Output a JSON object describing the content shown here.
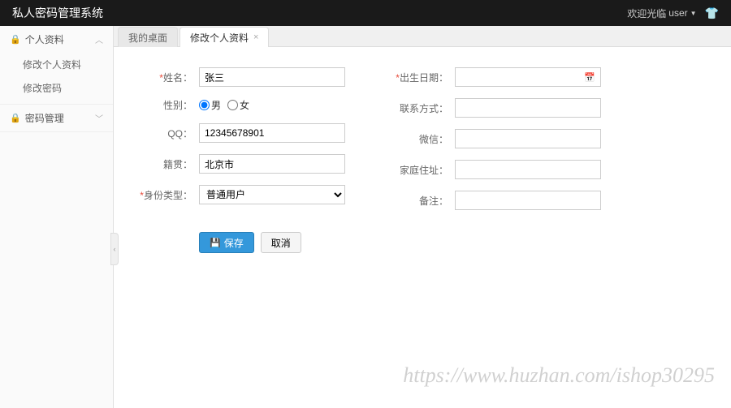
{
  "header": {
    "title": "私人密码管理系统",
    "welcome": "欢迎光临",
    "username": "user"
  },
  "sidebar": {
    "groups": [
      {
        "label": "个人资料",
        "items": [
          {
            "label": "修改个人资料"
          },
          {
            "label": "修改密码"
          }
        ]
      },
      {
        "label": "密码管理"
      }
    ]
  },
  "tabs": [
    {
      "label": "我的桌面",
      "active": false
    },
    {
      "label": "修改个人资料",
      "active": true,
      "closable": true
    }
  ],
  "form": {
    "left": {
      "name": {
        "label": "姓名",
        "value": "张三",
        "required": true
      },
      "gender": {
        "label": "性别",
        "male": "男",
        "female": "女",
        "value": "male"
      },
      "qq": {
        "label": "QQ",
        "value": "12345678901"
      },
      "hometown": {
        "label": "籍贯",
        "value": "北京市"
      },
      "idtype": {
        "label": "身份类型",
        "value": "普通用户",
        "required": true
      }
    },
    "right": {
      "birthday": {
        "label": "出生日期",
        "value": "",
        "required": true
      },
      "contact": {
        "label": "联系方式",
        "value": ""
      },
      "wechat": {
        "label": "微信",
        "value": ""
      },
      "address": {
        "label": "家庭住址",
        "value": ""
      },
      "remark": {
        "label": "备注",
        "value": ""
      }
    },
    "actions": {
      "save": "保存",
      "cancel": "取消"
    }
  },
  "watermark": "https://www.huzhan.com/ishop30295",
  "colon": "："
}
